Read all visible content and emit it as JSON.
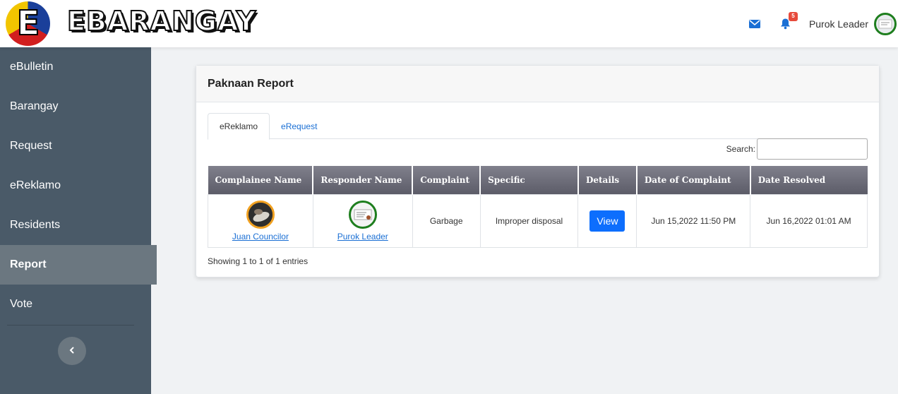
{
  "header": {
    "brand": "EBARANGAY",
    "logo_letter": "E",
    "notification_count": "5",
    "user_name": "Purok Leader",
    "icons": [
      "envelope-icon",
      "bell-icon"
    ]
  },
  "sidebar": {
    "items": [
      {
        "label": "eBulletin",
        "active": false
      },
      {
        "label": "Barangay",
        "active": false
      },
      {
        "label": "Request",
        "active": false
      },
      {
        "label": "eReklamo",
        "active": false
      },
      {
        "label": "Residents",
        "active": false
      },
      {
        "label": "Report",
        "active": true
      },
      {
        "label": "Vote",
        "active": false
      }
    ]
  },
  "card": {
    "title": "Paknaan Report",
    "tabs": [
      {
        "label": "eReklamo",
        "active": true
      },
      {
        "label": "eRequest",
        "active": false
      }
    ],
    "search_label": "Search:",
    "search_value": "",
    "columns": [
      "Complainee Name",
      "Responder Name",
      "Complaint",
      "Specific",
      "Details",
      "Date of Complaint",
      "Date Resolved"
    ],
    "rows": [
      {
        "complainee": "Juan Councilor",
        "responder": "Purok Leader",
        "complaint": "Garbage",
        "specific": "Improper disposal",
        "details_label": "View",
        "date_complaint": "Jun 15,2022 11:50 PM",
        "date_resolved": "Jun 16,2022 01:01 AM"
      }
    ],
    "info": "Showing 1 to 1 of 1 entries"
  },
  "colors": {
    "sidebar_bg": "#4a5a68",
    "sidebar_active": "#6b7780",
    "primary": "#0d6efd",
    "badge": "#e74a3b"
  }
}
